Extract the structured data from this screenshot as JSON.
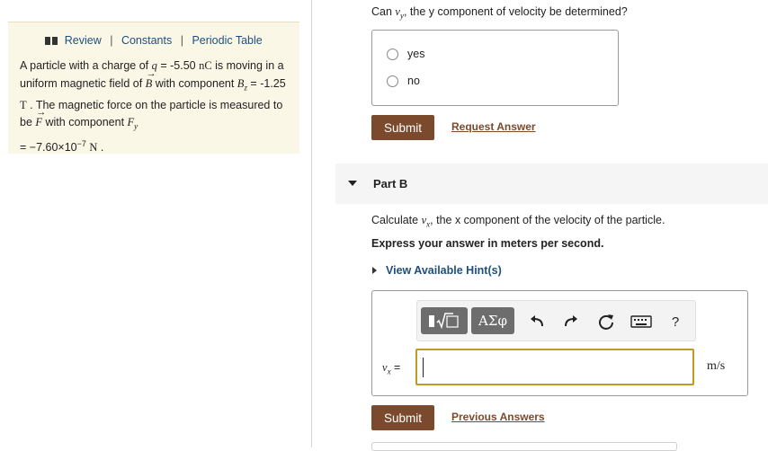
{
  "problem": {
    "links": {
      "review": "Review",
      "constants": "Constants",
      "periodic_table": "Periodic Table",
      "separator": "|"
    },
    "text": {
      "t1": "A particle with a charge of ",
      "q_sym": "q",
      "t2": " = -5.50 ",
      "q_unit": "nC",
      "t3": " is moving in a uniform magnetic field of ",
      "b_sym": "B",
      "t4": " with component ",
      "bz_sym": "B",
      "bz_sub": "z",
      "t5": " = -1.25 ",
      "bz_unit": "T",
      "t6": " . The magnetic force on the particle is measured to be ",
      "f_sym": "F",
      "t7": " with component ",
      "fy_sym": "F",
      "fy_sub": "y",
      "t8": " = −7.60×10",
      "fy_exp": "−7",
      "fy_unit": "N",
      "t9": " ."
    }
  },
  "part_a": {
    "q_pre": "Can ",
    "q_var": "v",
    "q_sub": "y",
    "q_post": ", the y component of velocity be determined?",
    "choices": [
      "yes",
      "no"
    ],
    "submit": "Submit",
    "request": "Request Answer"
  },
  "part_b": {
    "title": "Part B",
    "q_pre": "Calculate ",
    "q_var": "v",
    "q_sub": "x",
    "q_post": ", the x component of the velocity of the particle.",
    "instruction": "Express your answer in meters per second.",
    "hints": "View Available Hint(s)",
    "toolbar": {
      "greek": "ΑΣφ",
      "help": "?"
    },
    "var_label": "v",
    "var_sub": "x",
    "var_eq": " =",
    "units": "m/s",
    "submit": "Submit",
    "previous": "Previous Answers"
  }
}
